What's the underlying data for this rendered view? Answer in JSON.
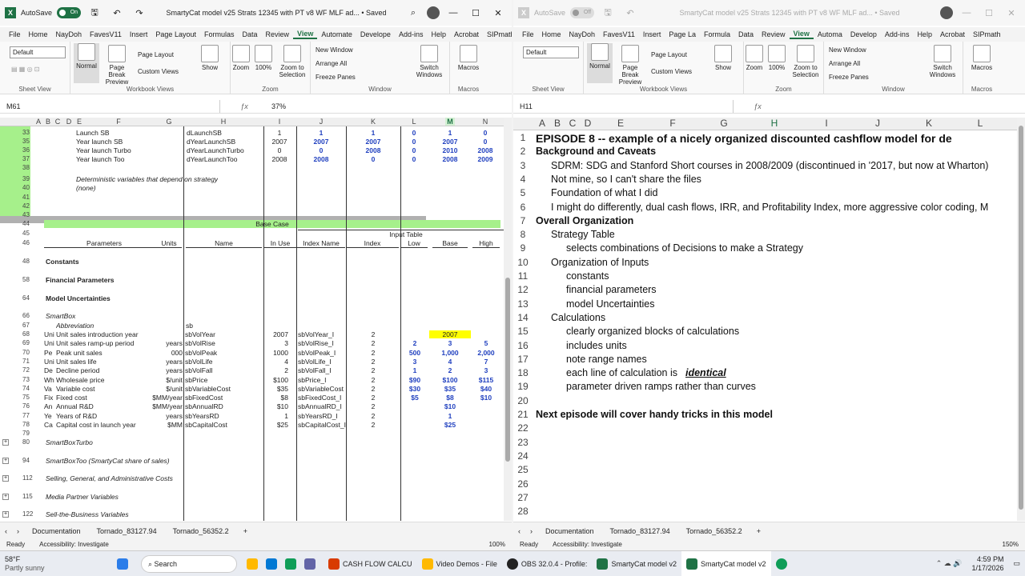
{
  "left": {
    "autosave_label": "AutoSave",
    "autosave_state": "On",
    "title": "SmartyCat model v25 Strats 12345 with PT v8 WF MLF ad... • Saved",
    "menu": [
      "File",
      "Home",
      "NayDoh",
      "FavesV11",
      "Insert",
      "Page Layout",
      "Formulas",
      "Data",
      "Review",
      "View",
      "Automate",
      "Develope",
      "Add-ins",
      "Help",
      "Acrobat",
      "SIPmath I"
    ],
    "active_menu": "View",
    "ribbon": {
      "view_select": "Default",
      "normal": "Normal",
      "page_break": "Page Break Preview",
      "page_layout": "Page Layout",
      "custom_views": "Custom Views",
      "show": "Show",
      "zoom": "Zoom",
      "zoom100": "100%",
      "zoom_sel": "Zoom to Selection",
      "new_window": "New Window",
      "arrange_all": "Arrange All",
      "freeze": "Freeze Panes",
      "switch": "Switch Windows",
      "macros": "Macros",
      "g_sheet": "Sheet View",
      "g_wbviews": "Workbook Views",
      "g_zoom": "Zoom",
      "g_window": "Window",
      "g_macros": "Macros"
    },
    "namebox": "M61",
    "formula": "37%",
    "cols": [
      "A",
      "B",
      "C",
      "D",
      "E",
      "F",
      "G",
      "H",
      "I",
      "J",
      "K",
      "L",
      "M",
      "N"
    ],
    "rows": [
      {
        "n": "33",
        "F": "Launch SB",
        "H": "dLaunchSB",
        "I": "1",
        "J": "1",
        "K": "1",
        "L": "0",
        "M": "1",
        "N": "0"
      },
      {
        "n": "35",
        "F": "Year launch SB",
        "H": "dYearLaunchSB",
        "I": "2007",
        "J": "2007",
        "K": "2007",
        "L": "0",
        "M": "2007",
        "N": "0"
      },
      {
        "n": "36",
        "F": "Year launch Turbo",
        "H": "dYearLaunchTurbo",
        "I": "0",
        "J": "0",
        "K": "2008",
        "L": "0",
        "M": "2010",
        "N": "2008"
      },
      {
        "n": "37",
        "F": "Year launch Too",
        "H": "dYearLaunchToo",
        "I": "2008",
        "J": "2008",
        "K": "0",
        "L": "0",
        "M": "2008",
        "N": "2009"
      }
    ],
    "det_label": "Deterministic variables that depend on strategy",
    "det_none": "(none)",
    "base_case": "Base Case",
    "input_table": "Input Table",
    "hdr": {
      "params": "Parameters",
      "units": "Units",
      "name": "Name",
      "inuse": "In Use",
      "idxname": "Index Name",
      "index": "Index",
      "low": "Low",
      "base": "Base",
      "high": "High"
    },
    "sections": {
      "constants": "Constants",
      "fin": "Financial Parameters",
      "model": "Model Uncertainties",
      "smartbox": "SmartBox",
      "abbr": "Abbreviation",
      "sb": "sb"
    },
    "params": [
      {
        "n": "68",
        "a": "Uni",
        "p": "Unit sales introduction year",
        "u": "",
        "nm": "sbVolYear",
        "iu": "2007",
        "ix": "sbVolYear_I",
        "i": "2",
        "lo": "",
        "ba": "2007",
        "hi": ""
      },
      {
        "n": "69",
        "a": "Uni",
        "p": "Unit sales ramp-up period",
        "u": "years",
        "nm": "sbVolRise",
        "iu": "3",
        "ix": "sbVolRise_I",
        "i": "2",
        "lo": "2",
        "ba": "3",
        "hi": "5"
      },
      {
        "n": "70",
        "a": "Pe",
        "p": "Peak unit sales",
        "u": "000",
        "nm": "sbVolPeak",
        "iu": "1000",
        "ix": "sbVolPeak_I",
        "i": "2",
        "lo": "500",
        "ba": "1,000",
        "hi": "2,000"
      },
      {
        "n": "71",
        "a": "Uni",
        "p": "Unit sales life",
        "u": "years",
        "nm": "sbVolLife",
        "iu": "4",
        "ix": "sbVolLife_I",
        "i": "2",
        "lo": "3",
        "ba": "4",
        "hi": "7"
      },
      {
        "n": "72",
        "a": "De",
        "p": "Decline period",
        "u": "years",
        "nm": "sbVolFall",
        "iu": "2",
        "ix": "sbVolFall_I",
        "i": "2",
        "lo": "1",
        "ba": "2",
        "hi": "3"
      },
      {
        "n": "73",
        "a": "Wh",
        "p": "Wholesale price",
        "u": "$/unit",
        "nm": "sbPrice",
        "iu": "$100",
        "ix": "sbPrice_I",
        "i": "2",
        "lo": "$90",
        "ba": "$100",
        "hi": "$115"
      },
      {
        "n": "74",
        "a": "Va",
        "p": "Variable cost",
        "u": "$/unit",
        "nm": "sbVariableCost",
        "iu": "$35",
        "ix": "sbVariableCost",
        "i": "2",
        "lo": "$30",
        "ba": "$35",
        "hi": "$40"
      },
      {
        "n": "75",
        "a": "Fix",
        "p": "Fixed cost",
        "u": "$MM/year",
        "nm": "sbFixedCost",
        "iu": "$8",
        "ix": "sbFixedCost_I",
        "i": "2",
        "lo": "$5",
        "ba": "$8",
        "hi": "$10"
      },
      {
        "n": "76",
        "a": "An",
        "p": "Annual R&D",
        "u": "$MM/year",
        "nm": "sbAnnualRD",
        "iu": "$10",
        "ix": "sbAnnualRD_I",
        "i": "2",
        "lo": "",
        "ba": "$10",
        "hi": ""
      },
      {
        "n": "77",
        "a": "Ye",
        "p": "Years of R&D",
        "u": "years",
        "nm": "sbYearsRD",
        "iu": "1",
        "ix": "sbYearsRD_I",
        "i": "2",
        "lo": "",
        "ba": "1",
        "hi": ""
      },
      {
        "n": "78",
        "a": "Ca",
        "p": "Capital cost in launch year",
        "u": "$MM",
        "nm": "sbCapitalCost",
        "iu": "$25",
        "ix": "sbCapitalCost_I",
        "i": "2",
        "lo": "",
        "ba": "$25",
        "hi": ""
      }
    ],
    "lower": [
      {
        "n": "80",
        "t": "SmartBoxTurbo"
      },
      {
        "n": "94",
        "t": "SmartBoxToo (SmartyCat share of sales)"
      },
      {
        "n": "112",
        "t": "Selling, General, and Administrative Costs"
      },
      {
        "n": "115",
        "t": "Media Partner Variables"
      },
      {
        "n": "122",
        "t": "Sell-the-Business Variables"
      }
    ],
    "tabs": [
      "Documentation",
      "Tornado_83127.94",
      "Tornado_56352.2"
    ],
    "status_ready": "Ready",
    "accessibility": "Accessibility: Investigate",
    "zoom_pct": "100%"
  },
  "right": {
    "autosave_label": "AutoSave",
    "autosave_state": "Off",
    "title": "SmartyCat model v25 Strats 12345 with PT v8 WF MLF ad... • Saved",
    "menu": [
      "File",
      "Home",
      "NayDoh",
      "FavesV11",
      "Insert",
      "Page La",
      "Formula",
      "Data",
      "Review",
      "View",
      "Automa",
      "Develop",
      "Add-ins",
      "Help",
      "Acrobat",
      "SIPmath"
    ],
    "namebox": "H11",
    "cols": [
      "A",
      "B",
      "C",
      "D",
      "E",
      "F",
      "G",
      "H",
      "I",
      "J",
      "K",
      "L"
    ],
    "lines": [
      {
        "n": "1",
        "t": "EPISODE 8 -- example of a nicely organized discounted cashflow model for de",
        "lvl": 0,
        "b": true
      },
      {
        "n": "2",
        "t": "Background and Caveats",
        "lvl": 0,
        "b": true
      },
      {
        "n": "3",
        "t": "SDRM: SDG and Stanford Short courses in 2008/2009 (discontinued in '2017, but now at Wharton)",
        "lvl": 1
      },
      {
        "n": "4",
        "t": "Not mine, so I can't share the files",
        "lvl": 1
      },
      {
        "n": "5",
        "t": "Foundation of what I did",
        "lvl": 1
      },
      {
        "n": "6",
        "t": "I might do differently, dual cash flows, IRR, and Profitability Index, more aggressive color coding, M",
        "lvl": 1
      },
      {
        "n": "7",
        "t": "Overall Organization",
        "lvl": 0,
        "b": true
      },
      {
        "n": "8",
        "t": "Strategy Table",
        "lvl": 1
      },
      {
        "n": "9",
        "t": "selects combinations of Decisions to make a Strategy",
        "lvl": 2
      },
      {
        "n": "10",
        "t": "Organization of Inputs",
        "lvl": 1
      },
      {
        "n": "11",
        "t": "constants",
        "lvl": 2
      },
      {
        "n": "12",
        "t": "financial parameters",
        "lvl": 2
      },
      {
        "n": "13",
        "t": "model Uncertainties",
        "lvl": 2
      },
      {
        "n": "14",
        "t": "Calculations",
        "lvl": 1
      },
      {
        "n": "15",
        "t": "clearly organized blocks of calculations",
        "lvl": 2
      },
      {
        "n": "16",
        "t": "includes units",
        "lvl": 2
      },
      {
        "n": "17",
        "t": "note range names",
        "lvl": 2
      },
      {
        "n": "18",
        "t": "each line of calculation is ",
        "em": "identical",
        "lvl": 2
      },
      {
        "n": "19",
        "t": "parameter driven ramps rather than curves",
        "lvl": 2
      },
      {
        "n": "20",
        "t": "",
        "lvl": 0
      },
      {
        "n": "21",
        "t": "Next episode will cover handy tricks in this model",
        "lvl": 0,
        "b": true
      },
      {
        "n": "22",
        "t": "",
        "lvl": 0
      },
      {
        "n": "23",
        "t": "",
        "lvl": 0
      },
      {
        "n": "24",
        "t": "",
        "lvl": 0
      },
      {
        "n": "25",
        "t": "",
        "lvl": 0
      },
      {
        "n": "26",
        "t": "",
        "lvl": 0
      },
      {
        "n": "27",
        "t": "",
        "lvl": 0
      },
      {
        "n": "28",
        "t": "",
        "lvl": 0
      }
    ],
    "tabs": [
      "Documentation",
      "Tornado_83127.94",
      "Tornado_56352.2"
    ],
    "status_ready": "Ready",
    "accessibility": "Accessibility: Investigate",
    "zoom_pct": "150%"
  },
  "taskbar": {
    "weather_temp": "58°F",
    "weather_desc": "Partly sunny",
    "search": "Search",
    "items": [
      "CASH FLOW CALCU",
      "Video Demos - File",
      "OBS 32.0.4 - Profile:",
      "SmartyCat model v2",
      "SmartyCat model v2"
    ],
    "time": "4:59 PM",
    "date": "1/17/2026",
    "badge": "5"
  },
  "colors": {
    "excel_green": "#1f7245",
    "light_green": "#a6f08b",
    "yellow": "#ffff00",
    "input_blue": "#1f3fbf"
  }
}
